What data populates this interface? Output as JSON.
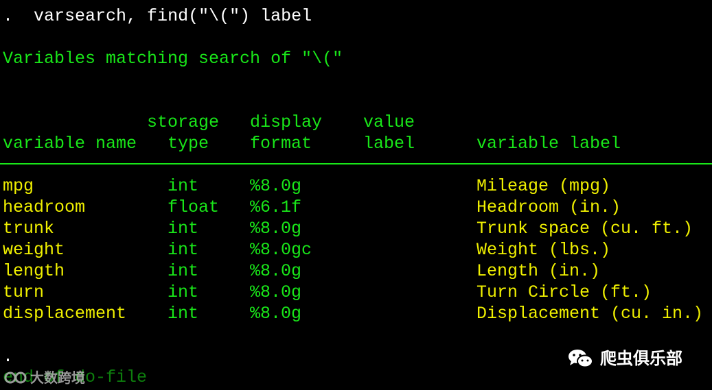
{
  "console": {
    "command_prompt": ".",
    "command_text": "varsearch, find(\"\\(\") label",
    "result_title": "Variables matching search of \"\\(\"",
    "headers": {
      "storage": "storage",
      "display": "display",
      "value": "value",
      "variable_name": "variable name",
      "type": "type",
      "format": "format",
      "label": "label",
      "variable_label": "variable label"
    },
    "rows": [
      {
        "name": "mpg",
        "type": "int",
        "format": "%8.0g",
        "value_label": "",
        "label": "Mileage (mpg)"
      },
      {
        "name": "headroom",
        "type": "float",
        "format": "%6.1f",
        "value_label": "",
        "label": "Headroom (in.)"
      },
      {
        "name": "trunk",
        "type": "int",
        "format": "%8.0g",
        "value_label": "",
        "label": "Trunk space (cu. ft.)"
      },
      {
        "name": "weight",
        "type": "int",
        "format": "%8.0gc",
        "value_label": "",
        "label": "Weight (lbs.)"
      },
      {
        "name": "length",
        "type": "int",
        "format": "%8.0g",
        "value_label": "",
        "label": "Length (in.)"
      },
      {
        "name": "turn",
        "type": "int",
        "format": "%8.0g",
        "value_label": "",
        "label": "Turn Circle (ft.)"
      },
      {
        "name": "displacement",
        "type": "int",
        "format": "%8.0g",
        "value_label": "",
        "label": "Displacement (cu. in.)"
      }
    ],
    "end_prompt": ".",
    "end_text": "end of do-file"
  },
  "watermarks": {
    "right_text": "爬虫俱乐部",
    "right_icon": "wechat-icon",
    "left_text": "大数跨境",
    "left_icon": "logo-icon"
  },
  "colors": {
    "background": "#000000",
    "command": "#ffffff",
    "result": "#19e619",
    "value": "#f0f000"
  }
}
